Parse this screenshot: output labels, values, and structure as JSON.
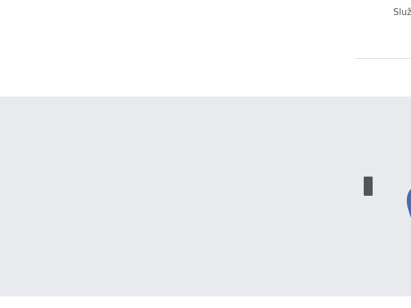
{
  "header": {
    "nav_link_label": "Služ"
  },
  "hero": {
    "background_color": "#e9eaed",
    "shape_color": "#4e6aa7",
    "handle_color": "#525456"
  }
}
